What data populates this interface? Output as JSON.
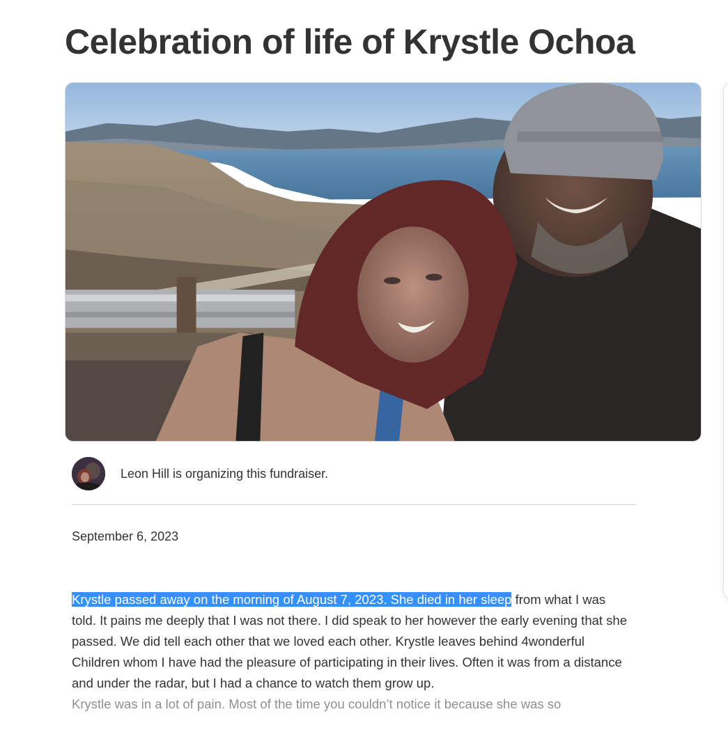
{
  "page": {
    "title": "Celebration of life of Krystle Ochoa"
  },
  "hero_image": {
    "alt": "Photo of Krystle Ochoa and Leon Hill at a lake overlook"
  },
  "organizer": {
    "text": "Leon Hill is organizing this fundraiser."
  },
  "post": {
    "date": "September 6, 2023",
    "highlighted": "Krystle passed away on the morning of August 7, 2023. She died in her sleep",
    "paragraph1_rest": " from what I was told. It pains me deeply that I was not there. I did speak to her however the early evening that she passed. We did tell each other that we loved each other. Krystle leaves behind 4wonderful Children whom I have had the pleasure of participating in their lives. Often it was from a distance and under the radar, but I had a chance to watch them grow up.",
    "paragraph2": "Krystle was in a lot of pain. Most of the time you couldn’t notice it because she was so"
  },
  "colors": {
    "selection": "#3390ff",
    "text": "#333333"
  }
}
